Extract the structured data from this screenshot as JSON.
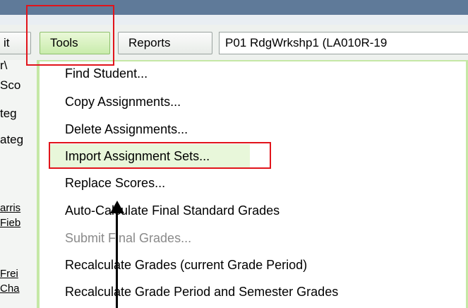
{
  "toolbar": {
    "edit_label": "it",
    "tools_label": "Tools",
    "reports_label": "Reports",
    "course_label": "P01  RdgWrkshp1 (LA010R-19"
  },
  "left_column": {
    "fragments": [
      "r\\",
      "Sco",
      "teg",
      "ateg",
      "arris",
      "Fieb",
      "Frei",
      "Cha"
    ]
  },
  "tools_menu": {
    "items": [
      {
        "label": "Find Student...",
        "enabled": true
      },
      {
        "label": "Copy Assignments...",
        "enabled": true
      },
      {
        "label": "Delete Assignments...",
        "enabled": true
      },
      {
        "label": "Import Assignment Sets...",
        "enabled": true,
        "highlighted": true
      },
      {
        "label": "Replace Scores...",
        "enabled": true
      },
      {
        "label": "Auto-Calculate Final Standard Grades",
        "enabled": true
      },
      {
        "label": "Submit Final Grades...",
        "enabled": false
      },
      {
        "label": "Recalculate Grades (current Grade Period)",
        "enabled": true
      },
      {
        "label": "Recalculate Grade Period and Semester Grades",
        "enabled": true
      }
    ]
  },
  "colors": {
    "top_bar": "#5f7a99",
    "menu_border": "#c5e8a6",
    "highlight_row": "#e8f7da",
    "annotation_red": "#e1141b"
  }
}
